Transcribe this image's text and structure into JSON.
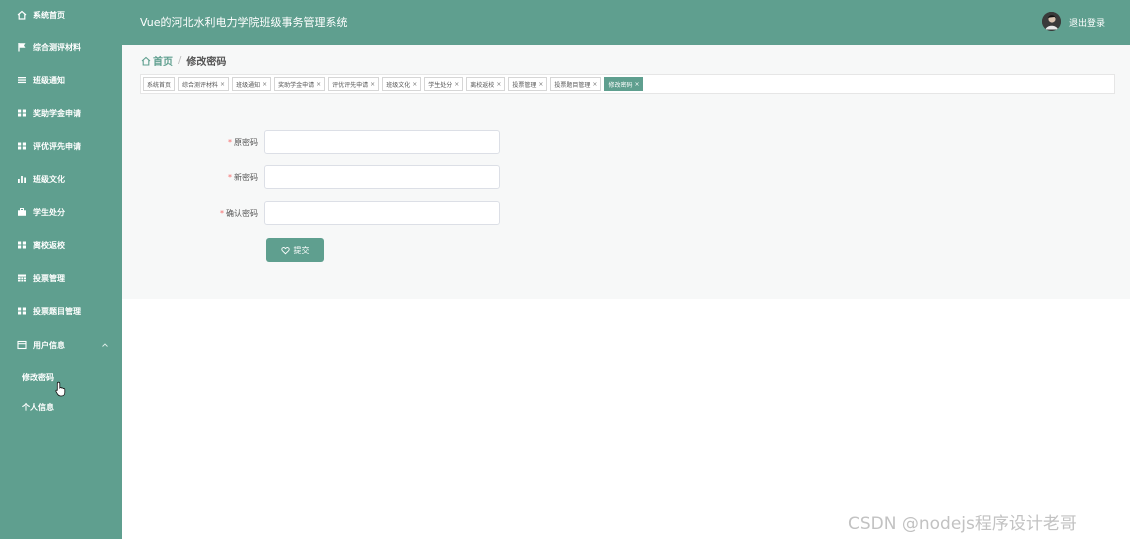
{
  "header": {
    "title": "Vue的河北水利电力学院班级事务管理系统",
    "logout_label": "退出登录"
  },
  "sidebar": {
    "items": [
      {
        "label": "系统首页",
        "icon": "home-icon"
      },
      {
        "label": "综合测评材料",
        "icon": "flag-icon"
      },
      {
        "label": "班级通知",
        "icon": "list-icon"
      },
      {
        "label": "奖助学金申请",
        "icon": "grid-icon"
      },
      {
        "label": "评优评先申请",
        "icon": "grid-icon"
      },
      {
        "label": "班级文化",
        "icon": "bar-chart-icon"
      },
      {
        "label": "学生处分",
        "icon": "briefcase-icon"
      },
      {
        "label": "离校返校",
        "icon": "grid-icon"
      },
      {
        "label": "投票管理",
        "icon": "table-icon"
      },
      {
        "label": "投票题目管理",
        "icon": "grid-icon"
      },
      {
        "label": "用户信息",
        "icon": "window-icon"
      }
    ],
    "sub_items": [
      {
        "label": "修改密码"
      },
      {
        "label": "个人信息"
      }
    ]
  },
  "breadcrumb": {
    "home": "首页",
    "separator": "/",
    "current": "修改密码"
  },
  "tags": [
    {
      "label": "系统首页",
      "closable": false
    },
    {
      "label": "综合测评材料",
      "closable": true
    },
    {
      "label": "班级通知",
      "closable": true
    },
    {
      "label": "奖助学金申请",
      "closable": true
    },
    {
      "label": "评优评先申请",
      "closable": true
    },
    {
      "label": "班级文化",
      "closable": true
    },
    {
      "label": "学生处分",
      "closable": true
    },
    {
      "label": "离校返校",
      "closable": true
    },
    {
      "label": "投票管理",
      "closable": true
    },
    {
      "label": "投票题目管理",
      "closable": true
    },
    {
      "label": "修改密码",
      "closable": true,
      "active": true
    }
  ],
  "form": {
    "old_password_label": "原密码",
    "new_password_label": "新密码",
    "confirm_password_label": "确认密码",
    "old_password_value": "",
    "new_password_value": "",
    "confirm_password_value": "",
    "required_mark": "*",
    "submit_label": "提交"
  },
  "watermark": "CSDN @nodejs程序设计老哥",
  "colors": {
    "primary": "#5f9f8f",
    "required": "#f56c6c"
  }
}
